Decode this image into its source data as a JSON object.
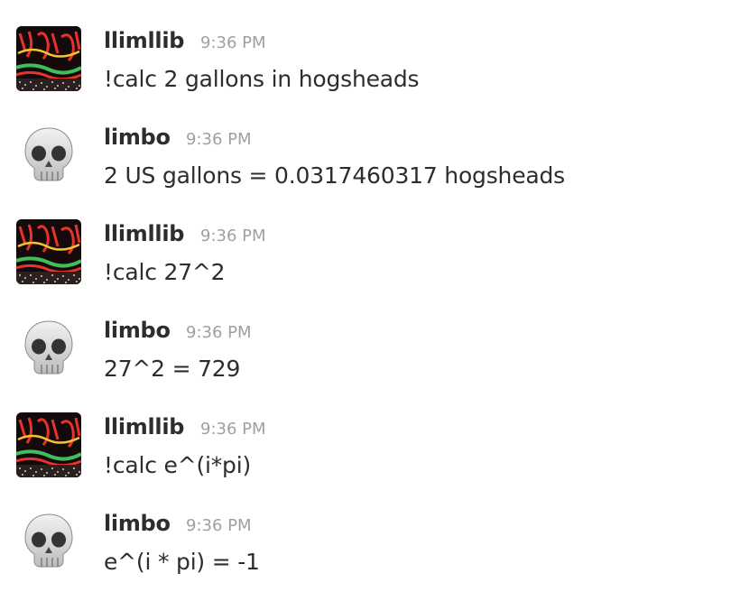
{
  "messages": [
    {
      "user": "llimllib",
      "time": "9:36 PM",
      "text": "!calc 2 gallons in hogsheads",
      "avatar": "neon-sign-avatar"
    },
    {
      "user": "limbo",
      "time": "9:36 PM",
      "text": "2 US gallons = 0.0317460317 hogsheads",
      "avatar": "skull-icon"
    },
    {
      "user": "llimllib",
      "time": "9:36 PM",
      "text": "!calc 27^2",
      "avatar": "neon-sign-avatar"
    },
    {
      "user": "limbo",
      "time": "9:36 PM",
      "text": "27^2 = 729",
      "avatar": "skull-icon"
    },
    {
      "user": "llimllib",
      "time": "9:36 PM",
      "text": "!calc e^(i*pi)",
      "avatar": "neon-sign-avatar"
    },
    {
      "user": "limbo",
      "time": "9:36 PM",
      "text": "e^(i * pi) = -1",
      "avatar": "skull-icon"
    }
  ],
  "colors": {
    "username": "#2c2d30",
    "timestamp": "#a0a0a2",
    "text": "#2c2d30",
    "neon_red": "#e8322a",
    "neon_green": "#3fbf5a",
    "neon_yellow": "#f4c431"
  }
}
